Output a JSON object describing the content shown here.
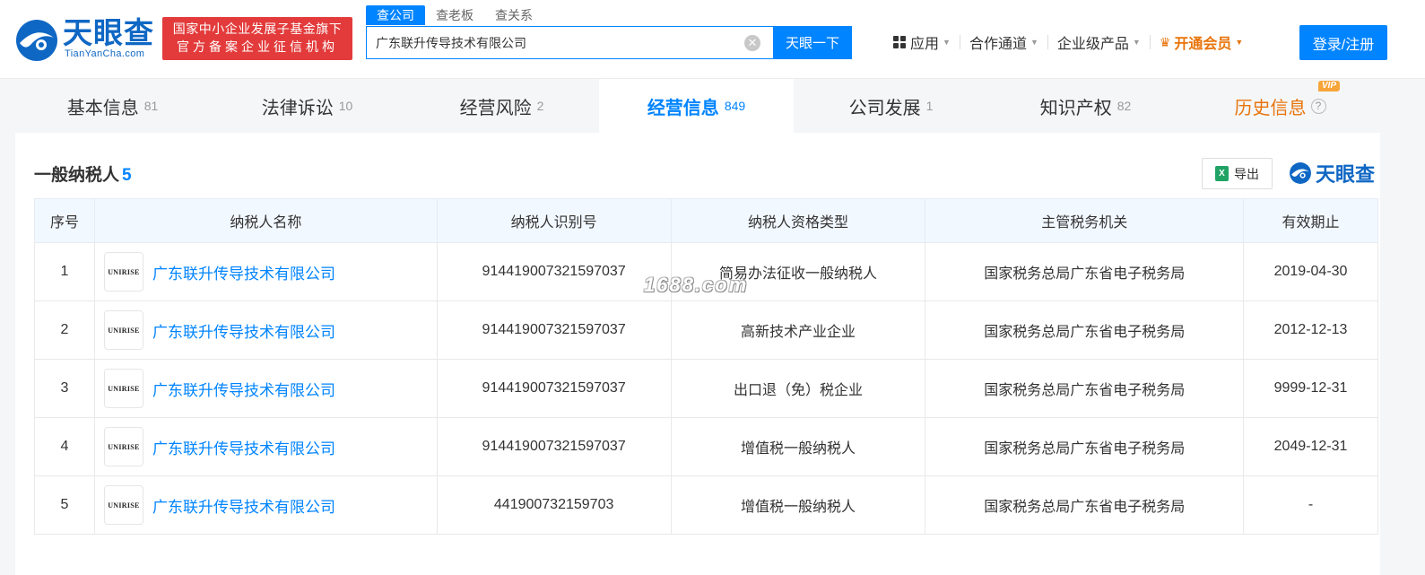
{
  "header": {
    "logo_text": "天眼查",
    "logo_sub": "TianYanCha.com",
    "badge_line1": "国家中小企业发展子基金旗下",
    "badge_line2": "官方备案企业征信机构",
    "search_tabs": [
      "查公司",
      "查老板",
      "查关系"
    ],
    "search_value": "广东联升传导技术有限公司",
    "search_button": "天眼一下",
    "nav": {
      "apps": "应用",
      "cooperation": "合作通道",
      "enterprise": "企业级产品",
      "vip": "开通会员"
    },
    "login": "登录/注册"
  },
  "tabs": [
    {
      "label": "基本信息",
      "count": "81"
    },
    {
      "label": "法律诉讼",
      "count": "10"
    },
    {
      "label": "经营风险",
      "count": "2"
    },
    {
      "label": "经营信息",
      "count": "849"
    },
    {
      "label": "公司发展",
      "count": "1"
    },
    {
      "label": "知识产权",
      "count": "82"
    },
    {
      "label": "历史信息",
      "vip_tag": "VIP"
    }
  ],
  "section": {
    "title": "一般纳税人",
    "count": "5",
    "export": "导出",
    "brand": "天眼查"
  },
  "table": {
    "headers": [
      "序号",
      "纳税人名称",
      "纳税人识别号",
      "纳税人资格类型",
      "主管税务机关",
      "有效期止"
    ],
    "logo_text": "UNIRISE",
    "rows": [
      {
        "no": "1",
        "name": "广东联升传导技术有限公司",
        "tax_id": "914419007321597037",
        "type": "简易办法征收一般纳税人",
        "authority": "国家税务总局广东省电子税务局",
        "valid_until": "2019-04-30"
      },
      {
        "no": "2",
        "name": "广东联升传导技术有限公司",
        "tax_id": "914419007321597037",
        "type": "高新技术产业企业",
        "authority": "国家税务总局广东省电子税务局",
        "valid_until": "2012-12-13"
      },
      {
        "no": "3",
        "name": "广东联升传导技术有限公司",
        "tax_id": "914419007321597037",
        "type": "出口退（免）税企业",
        "authority": "国家税务总局广东省电子税务局",
        "valid_until": "9999-12-31"
      },
      {
        "no": "4",
        "name": "广东联升传导技术有限公司",
        "tax_id": "914419007321597037",
        "type": "增值税一般纳税人",
        "authority": "国家税务总局广东省电子税务局",
        "valid_until": "2049-12-31"
      },
      {
        "no": "5",
        "name": "广东联升传导技术有限公司",
        "tax_id": "441900732159703",
        "type": "增值税一般纳税人",
        "authority": "国家税务总局广东省电子税务局",
        "valid_until": "-"
      }
    ]
  },
  "watermark": "1688.com"
}
